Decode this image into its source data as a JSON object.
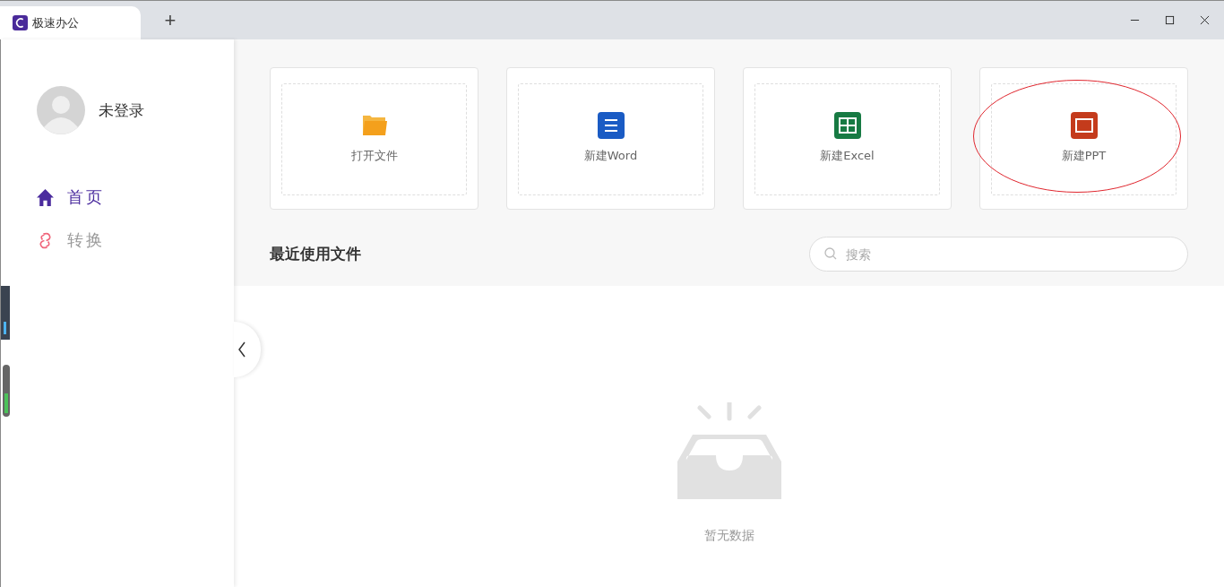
{
  "window": {
    "tab_title": "极速办公",
    "new_tab": "+"
  },
  "sidebar": {
    "user": {
      "name": "未登录"
    },
    "items": [
      {
        "label": "首页",
        "kind": "home",
        "selected": true
      },
      {
        "label": "转换",
        "kind": "convert",
        "selected": false
      }
    ]
  },
  "actions": [
    {
      "label": "打开文件",
      "kind": "folder",
      "circled": false
    },
    {
      "label": "新建Word",
      "kind": "word",
      "circled": false
    },
    {
      "label": "新建Excel",
      "kind": "excel",
      "circled": false
    },
    {
      "label": "新建PPT",
      "kind": "ppt",
      "circled": true
    }
  ],
  "recent": {
    "title": "最近使用文件",
    "search": {
      "placeholder": "搜索"
    },
    "empty_text": "暂无数据"
  }
}
